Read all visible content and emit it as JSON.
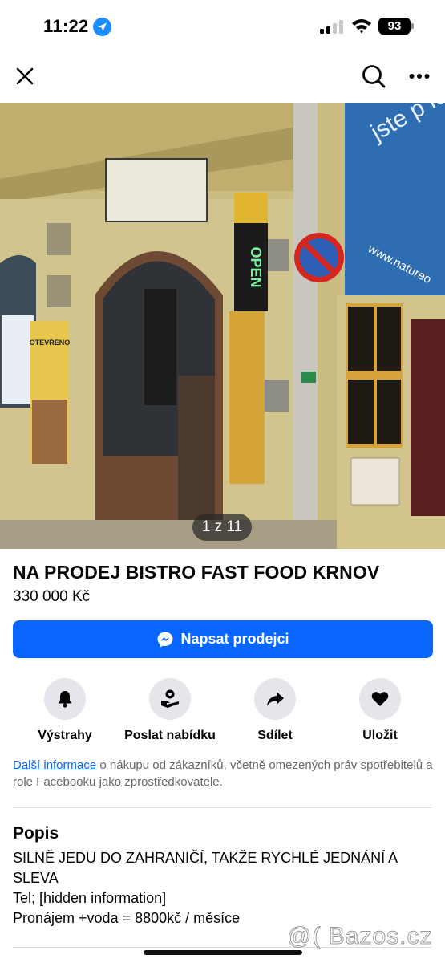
{
  "status_bar": {
    "time": "11:22",
    "battery": "93"
  },
  "nav": {
    "close_icon": "close-icon",
    "search_icon": "search-icon",
    "more_icon": "more-icon"
  },
  "photo": {
    "counter": "1 z 11",
    "visible_text": {
      "open_sign": "OPEN",
      "website": "www.natureo",
      "billboard_text": "jste p kde chce",
      "door_poster": "OTEVŘENO"
    }
  },
  "listing": {
    "title": "NA PRODEJ BISTRO FAST FOOD KRNOV",
    "price": "330 000 Kč",
    "message_button": "Napsat prodejci"
  },
  "actions": [
    {
      "label": "Výstrahy",
      "icon": "bell-icon"
    },
    {
      "label": "Poslat nabídku",
      "icon": "offer-icon"
    },
    {
      "label": "Sdílet",
      "icon": "share-icon"
    },
    {
      "label": "Uložit",
      "icon": "heart-icon"
    }
  ],
  "info": {
    "link": "Další informace",
    "text": " o nákupu od zákazníků, včetně omezených práv spotřebitelů a role Facebooku jako zprostředkovatele."
  },
  "description": {
    "heading": "Popis",
    "body": "SILNĚ JEDU DO ZAHRANIČÍ, TAKŽE RYCHLÉ JEDNÁNÍ A SLEVA\n Tel; [hidden information]\nPronájem +voda = 8800kč / měsíce"
  },
  "watermark": "@( Bazos.cz",
  "colors": {
    "accent": "#0866ff",
    "action_bg": "#e4e6eb",
    "secondary_text": "#65676b"
  }
}
